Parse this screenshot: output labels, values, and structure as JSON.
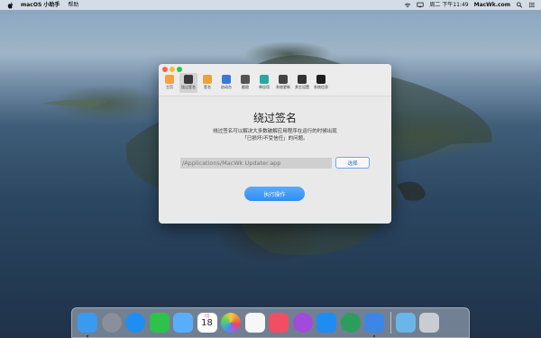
{
  "menubar": {
    "app_name": "macOS 小助手",
    "help": "帮助",
    "clock": "周二 下午11:49",
    "brand": "MacWk.com"
  },
  "toolbar": {
    "items": [
      {
        "label": "主页",
        "icon": "home-icon",
        "color": "#f3a33a"
      },
      {
        "label": "绕过签名",
        "icon": "pen-icon",
        "color": "#3a3a3a"
      },
      {
        "label": "签名",
        "icon": "sign-icon",
        "color": "#e9a33a"
      },
      {
        "label": "启动台",
        "icon": "launchpad-icon",
        "color": "#3a78d6"
      },
      {
        "label": "截图",
        "icon": "screenshot-icon",
        "color": "#555555"
      },
      {
        "label": "单应用",
        "icon": "single-app-icon",
        "color": "#2aa7a0"
      },
      {
        "label": "系统更新",
        "icon": "update-icon",
        "color": "#444444"
      },
      {
        "label": "其它设置",
        "icon": "settings-icon",
        "color": "#333333"
      },
      {
        "label": "系统信息",
        "icon": "terminal-icon",
        "color": "#1e1e1e"
      }
    ],
    "active_index": 1
  },
  "main": {
    "title": "绕过签名",
    "description_line1": "绕过签名可以解决大多数破解应用程序在运行的时候出现",
    "description_line2": "「已损坏/不受信任」的问题。",
    "path_value": "/Applications/MacWk Updater.app",
    "choose_label": "选择",
    "execute_label": "执行操作"
  },
  "dock": {
    "calendar_month": "7月",
    "calendar_day": "18",
    "apps": [
      {
        "name": "finder-icon",
        "color": "#3a9af0"
      },
      {
        "name": "launchpad-icon",
        "color": "#8a8f99"
      },
      {
        "name": "safari-icon",
        "color": "#1e8ef2"
      },
      {
        "name": "facetime-icon",
        "color": "#2ec24c"
      },
      {
        "name": "messages-icon",
        "color": "#5aaef9"
      },
      {
        "name": "calendar-icon",
        "color": "#ffffff"
      },
      {
        "name": "photos-icon",
        "color": "#f2f2f2"
      },
      {
        "name": "reminders-icon",
        "color": "#f7f7f7"
      },
      {
        "name": "music-icon",
        "color": "#f24d63"
      },
      {
        "name": "podcasts-icon",
        "color": "#a04bd9"
      },
      {
        "name": "app-store-icon",
        "color": "#1f8cf2"
      },
      {
        "name": "tool-icon",
        "color": "#2b9e5e"
      },
      {
        "name": "macos-helper-icon",
        "color": "#3e86e6"
      },
      {
        "name": "downloads-folder-icon",
        "color": "#6ab6e8"
      },
      {
        "name": "trash-icon",
        "color": "#c8cdd3"
      }
    ]
  }
}
